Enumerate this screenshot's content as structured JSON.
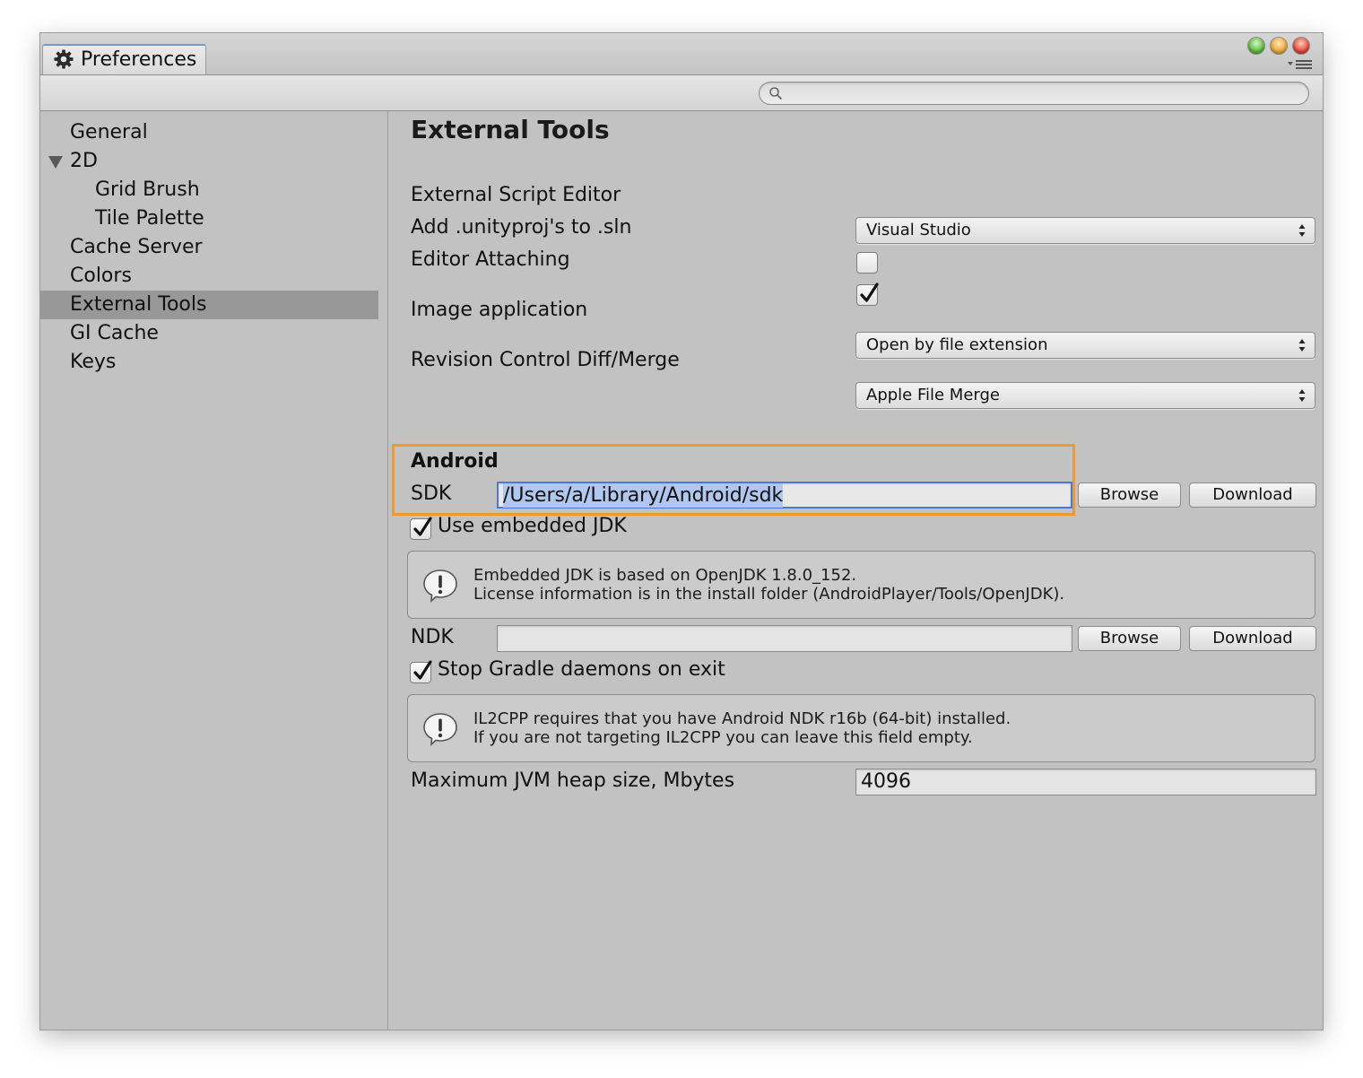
{
  "window": {
    "tab_title": "Preferences",
    "tab_icon": "gear-icon",
    "search": {
      "placeholder": "",
      "value": ""
    }
  },
  "sidebar": {
    "items": [
      {
        "label": "General"
      },
      {
        "label": "2D",
        "expanded": true
      },
      {
        "label": "Grid Brush"
      },
      {
        "label": "Tile Palette"
      },
      {
        "label": "Cache Server"
      },
      {
        "label": "Colors"
      },
      {
        "label": "External Tools",
        "selected": true
      },
      {
        "label": "GI Cache"
      },
      {
        "label": "Keys"
      }
    ]
  },
  "main": {
    "title": "External Tools",
    "script_editor": {
      "label": "External Script Editor",
      "value": "Visual Studio"
    },
    "add_unityproj": {
      "label": "Add .unityproj's to .sln",
      "checked": false
    },
    "editor_attaching": {
      "label": "Editor Attaching",
      "checked": true
    },
    "image_app": {
      "label": "Image application",
      "value": "Open by file extension"
    },
    "revision_control": {
      "label": "Revision Control Diff/Merge",
      "value": "Apple File Merge"
    },
    "android": {
      "header": "Android",
      "sdk": {
        "label": "SDK",
        "value": "/Users/a/Library/Android/sdk",
        "browse": "Browse",
        "download": "Download"
      },
      "embedded_jdk": {
        "label": "Use embedded JDK",
        "checked": true
      },
      "jdk_help": {
        "line1": "Embedded JDK is based on OpenJDK 1.8.0_152.",
        "line2": "License information is in the install folder (AndroidPlayer/Tools/OpenJDK)."
      },
      "ndk": {
        "label": "NDK",
        "value": "",
        "browse": "Browse",
        "download": "Download"
      },
      "stop_gradle": {
        "label": "Stop Gradle daemons on exit",
        "checked": true
      },
      "ndk_help": {
        "line1": "IL2CPP requires that you have Android NDK r16b (64-bit) installed.",
        "line2": "If you are not targeting IL2CPP you can leave this field empty."
      },
      "jvm_heap": {
        "label": "Maximum JVM heap size, Mbytes",
        "value": "4096"
      }
    }
  },
  "colors": {
    "highlight": "#ef9a31",
    "selection": "#b0c8ef",
    "focus": "#4a7ad6",
    "sidebar_selected": "#989898"
  }
}
